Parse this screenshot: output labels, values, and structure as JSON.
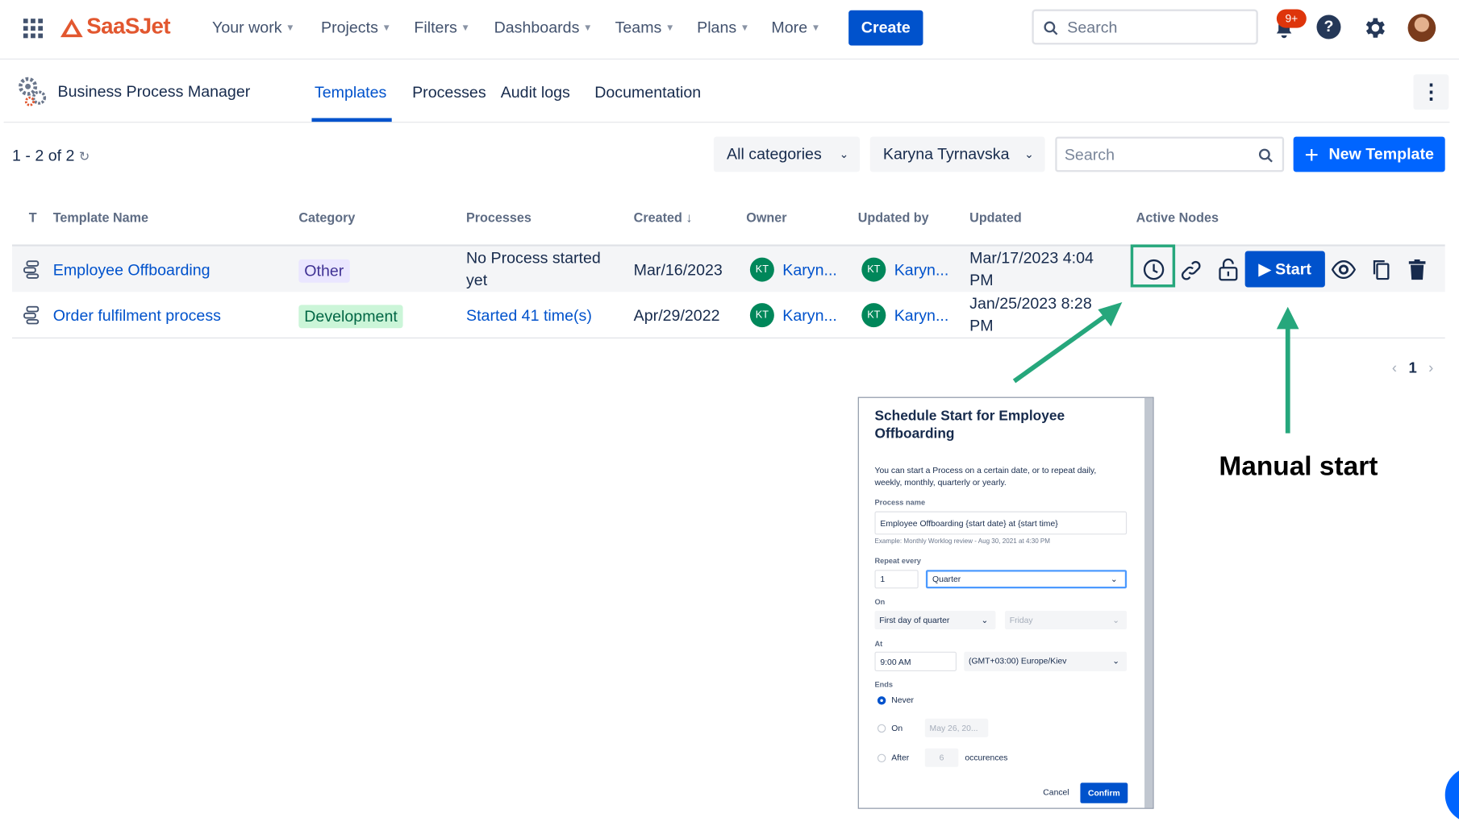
{
  "topnav": {
    "brand": "SaaSJet",
    "items": [
      "Your work",
      "Projects",
      "Filters",
      "Dashboards",
      "Teams",
      "Plans",
      "More"
    ],
    "create_label": "Create",
    "search_placeholder": "Search",
    "notification_badge": "9+",
    "help_glyph": "?"
  },
  "app": {
    "title": "Business Process Manager",
    "tabs": [
      "Templates",
      "Processes",
      "Audit logs",
      "Documentation"
    ],
    "active_tab": "Templates"
  },
  "toolbar": {
    "count": "1 - 2 of 2",
    "category_filter": "All categories",
    "owner_filter": "Karyna Tyrnavska",
    "search_placeholder": "Search",
    "new_template_label": "New Template"
  },
  "table": {
    "columns": [
      "T",
      "Template Name",
      "Category",
      "Processes",
      "Created ↓",
      "Owner",
      "Updated by",
      "Updated",
      "Active Nodes"
    ],
    "rows": [
      {
        "name": "Employee Offboarding",
        "category": "Other",
        "processes_line1": "No Process started",
        "processes_line2": "yet",
        "created": "Mar/16/2023",
        "owner_initials": "KT",
        "owner": "Karyn...",
        "updated_by_initials": "KT",
        "updated_by": "Karyn...",
        "updated_line1": "Mar/17/2023 4:04",
        "updated_line2": "PM",
        "start_label": "Start"
      },
      {
        "name": "Order fulfilment process",
        "category": "Development",
        "processes_line1": "Started 41 time(s)",
        "created": "Apr/29/2022",
        "owner_initials": "KT",
        "owner": "Karyn...",
        "updated_by_initials": "KT",
        "updated_by": "Karyn...",
        "updated_line1": "Jan/25/2023 8:28",
        "updated_line2": "PM"
      }
    ]
  },
  "pagination": {
    "prev": "‹",
    "current": "1",
    "next": "›"
  },
  "modal": {
    "title_line1": "Schedule Start for Employee",
    "title_line2": "Offboarding",
    "desc_line1": "You can start a Process on a certain date, or to repeat daily,",
    "desc_line2": "weekly, monthly, quarterly or yearly.",
    "process_name_label": "Process name",
    "process_name_value": "Employee Offboarding {start date} at {start time}",
    "example": "Example: Monthly Worklog review - Aug 30, 2021 at 4:30 PM",
    "repeat_label": "Repeat every",
    "repeat_value": "1",
    "repeat_unit": "Quarter",
    "on_label": "On",
    "on_value": "First day of quarter",
    "on_day": "Friday",
    "at_label": "At",
    "at_time": "9:00 AM",
    "timezone": "(GMT+03:00) Europe/Kiev",
    "ends_label": "Ends",
    "ends_never": "Never",
    "ends_on": "On",
    "ends_on_date": "May 26, 20...",
    "ends_after": "After",
    "ends_after_count": "6",
    "occurrences": "occurences",
    "cancel": "Cancel",
    "confirm": "Confirm"
  },
  "annotations": {
    "manual_start": "Manual start"
  },
  "colors": {
    "primary": "#0052cc",
    "annotation": "#26a77c",
    "owner_avatar": "#00875a"
  }
}
